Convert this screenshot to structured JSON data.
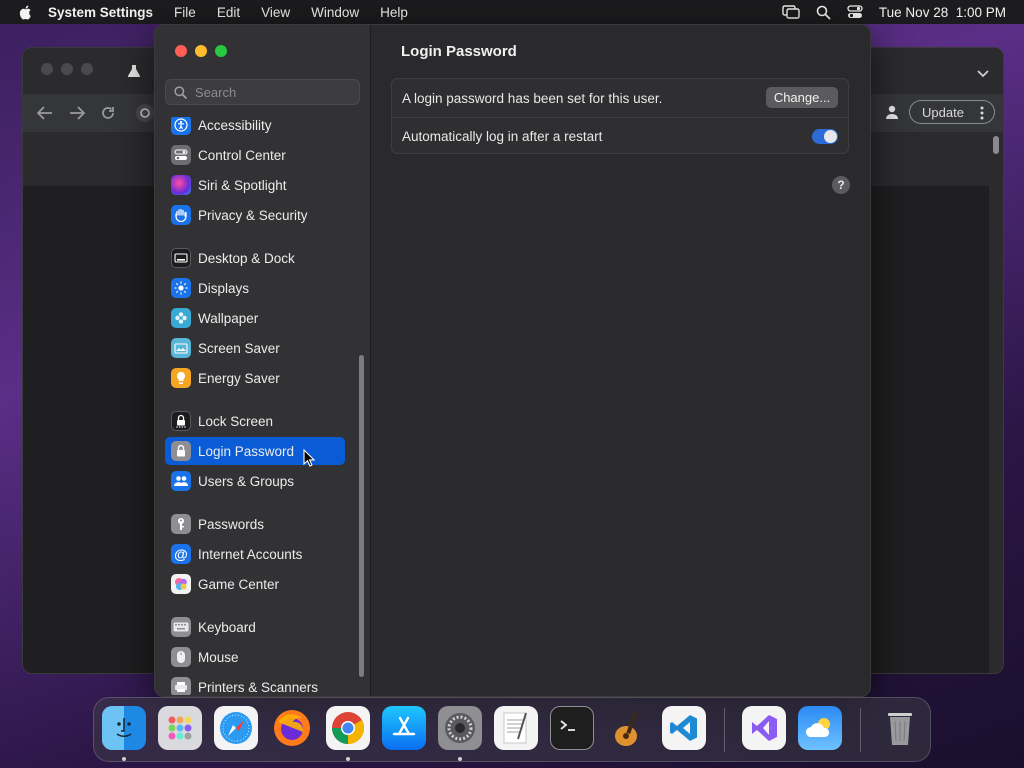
{
  "menubar": {
    "app_name": "System Settings",
    "menus": [
      "File",
      "Edit",
      "View",
      "Window",
      "Help"
    ],
    "datetime": "Tue Nov 28  1:00 PM"
  },
  "browser": {
    "update_label": "Update"
  },
  "settings": {
    "search_placeholder": "Search",
    "sidebar_items": [
      {
        "label": "Accessibility",
        "icon": "accessibility-icon",
        "color": "#1a73e8"
      },
      {
        "label": "Control Center",
        "icon": "control-center-icon",
        "color": "#6e6e73"
      },
      {
        "label": "Siri & Spotlight",
        "icon": "siri-icon",
        "color": "#c43cc8"
      },
      {
        "label": "Privacy & Security",
        "icon": "privacy-hand-icon",
        "color": "#1a73e8"
      },
      {
        "label": "Desktop & Dock",
        "icon": "desktop-dock-icon",
        "color": "#1c1c1e"
      },
      {
        "label": "Displays",
        "icon": "displays-icon",
        "color": "#1a73e8"
      },
      {
        "label": "Wallpaper",
        "icon": "wallpaper-icon",
        "color": "#3aa9d6"
      },
      {
        "label": "Screen Saver",
        "icon": "screen-saver-icon",
        "color": "#58b6d8"
      },
      {
        "label": "Energy Saver",
        "icon": "energy-saver-icon",
        "color": "#f5a623"
      },
      {
        "label": "Lock Screen",
        "icon": "lock-screen-icon",
        "color": "#1c1c1e"
      },
      {
        "label": "Login Password",
        "icon": "login-password-icon",
        "color": "#8e8e93",
        "selected": true
      },
      {
        "label": "Users & Groups",
        "icon": "users-groups-icon",
        "color": "#1a73e8"
      },
      {
        "label": "Passwords",
        "icon": "passwords-key-icon",
        "color": "#8e8e93"
      },
      {
        "label": "Internet Accounts",
        "icon": "internet-accounts-icon",
        "color": "#1a73e8"
      },
      {
        "label": "Game Center",
        "icon": "game-center-icon",
        "color": "#f2f2f2"
      },
      {
        "label": "Keyboard",
        "icon": "keyboard-icon",
        "color": "#8e8e93"
      },
      {
        "label": "Mouse",
        "icon": "mouse-icon",
        "color": "#8e8e93"
      },
      {
        "label": "Printers & Scanners",
        "icon": "printers-scanners-icon",
        "color": "#8e8e93"
      }
    ],
    "pane_title": "Login Password",
    "password_status": "A login password has been set for this user.",
    "change_label": "Change...",
    "auto_login_label": "Automatically log in after a restart",
    "auto_login_enabled": true,
    "help_label": "?"
  },
  "dock": {
    "apps": [
      "Finder",
      "Launchpad",
      "Safari",
      "Firefox",
      "Google Chrome",
      "App Store",
      "System Settings",
      "TextEdit",
      "Terminal",
      "GarageBand",
      "Visual Studio Code",
      "Visual Studio",
      "Weather",
      "Trash"
    ]
  }
}
